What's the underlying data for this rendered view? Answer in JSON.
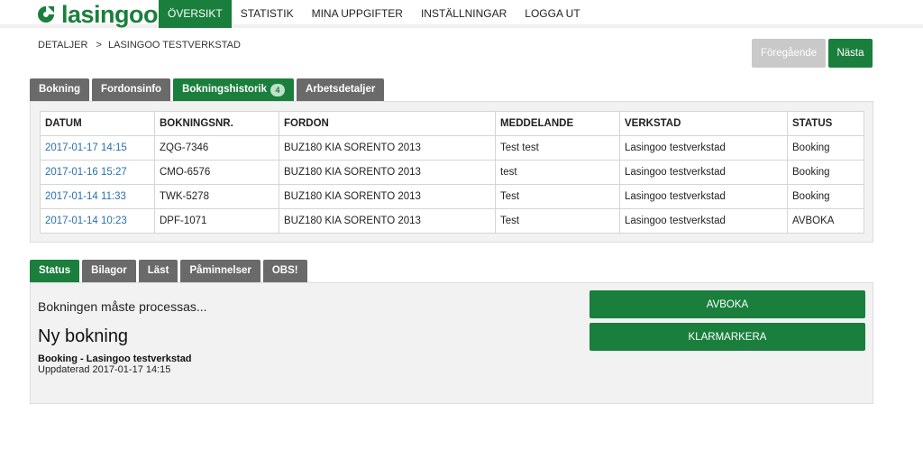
{
  "brand": {
    "name": "lasingoo",
    "logo_icon": "lasingoo-c-logo",
    "color": "#1a7f3c"
  },
  "nav": {
    "items": [
      {
        "label": "ÖVERSIKT",
        "active": true
      },
      {
        "label": "STATISTIK",
        "active": false
      },
      {
        "label": "MINA UPPGIFTER",
        "active": false
      },
      {
        "label": "INSTÄLLNINGAR",
        "active": false
      },
      {
        "label": "LOGGA UT",
        "active": false
      }
    ]
  },
  "breadcrumb": {
    "root": "DETALJER",
    "separator": ">",
    "current": "LASINGOO TESTVERKSTAD"
  },
  "pager": {
    "prev_label": "Föregående",
    "next_label": "Nästa"
  },
  "top_tabs": [
    {
      "label": "Bokning",
      "active": false
    },
    {
      "label": "Fordonsinfo",
      "active": false
    },
    {
      "label": "Bokningshistorik",
      "active": true,
      "badge": "4"
    },
    {
      "label": "Arbetsdetaljer",
      "active": false
    }
  ],
  "history_table": {
    "headers": [
      "DATUM",
      "BOKNINGSNR.",
      "FORDON",
      "MEDDELANDE",
      "VERKSTAD",
      "STATUS"
    ],
    "rows": [
      [
        "2017-01-17 14:15",
        "ZQG-7346",
        "BUZ180 KIA SORENTO 2013",
        "Test test",
        "Lasingoo testverkstad",
        "Booking"
      ],
      [
        "2017-01-16 15:27",
        "CMO-6576",
        "BUZ180 KIA SORENTO 2013",
        "test",
        "Lasingoo testverkstad",
        "Booking"
      ],
      [
        "2017-01-14 11:33",
        "TWK-5278",
        "BUZ180 KIA SORENTO 2013",
        "Test",
        "Lasingoo testverkstad",
        "Booking"
      ],
      [
        "2017-01-14 10:23",
        "DPF-1071",
        "BUZ180 KIA SORENTO 2013",
        "Test",
        "Lasingoo testverkstad",
        "AVBOKA"
      ]
    ]
  },
  "bottom_tabs": [
    {
      "label": "Status",
      "active": true
    },
    {
      "label": "Bilagor",
      "active": false
    },
    {
      "label": "Läst",
      "active": false
    },
    {
      "label": "Påminnelser",
      "active": false
    },
    {
      "label": "OBS!",
      "active": false
    }
  ],
  "status_panel": {
    "process_text": "Bokningen måste processas...",
    "title": "Ny bokning",
    "booking_line": "Booking - Lasingoo testverkstad",
    "updated_line": "Uppdaterad 2017-01-17 14:15",
    "avboka_label": "AVBOKA",
    "klarmarkera_label": "KLARMARKERA"
  }
}
